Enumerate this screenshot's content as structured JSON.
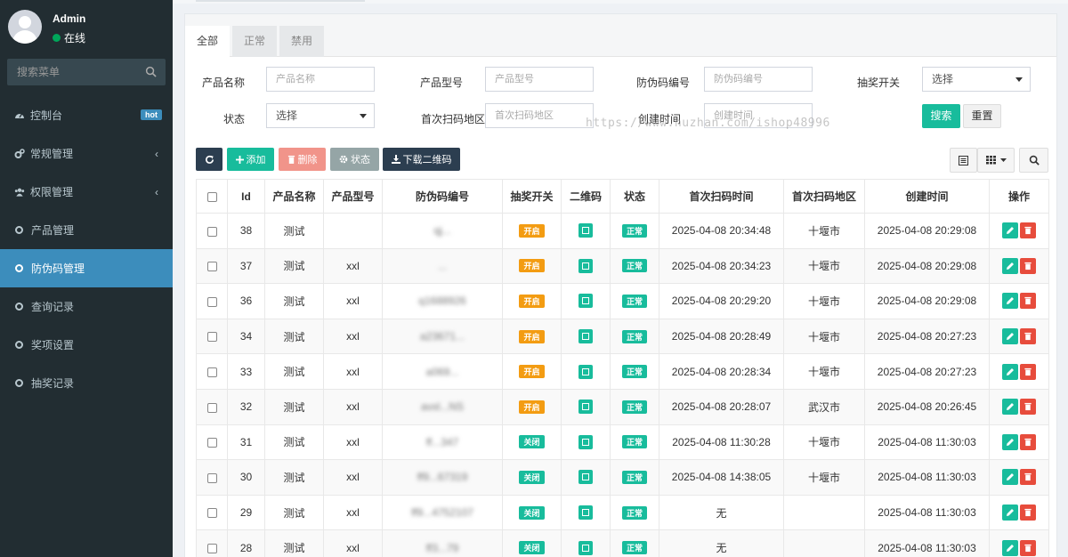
{
  "sidebar": {
    "user": {
      "name": "Admin",
      "status": "在线"
    },
    "search_placeholder": "搜索菜单",
    "menu": [
      {
        "label": "控制台",
        "icon": "dashboard-icon",
        "badge": "hot"
      },
      {
        "label": "常规管理",
        "icon": "cogs-icon",
        "chevron": "‹"
      },
      {
        "label": "权限管理",
        "icon": "group-icon",
        "chevron": "‹"
      },
      {
        "label": "产品管理",
        "icon": "circle-icon"
      },
      {
        "label": "防伪码管理",
        "icon": "circle-icon",
        "active": true
      },
      {
        "label": "查询记录",
        "icon": "circle-icon"
      },
      {
        "label": "奖项设置",
        "icon": "circle-icon"
      },
      {
        "label": "抽奖记录",
        "icon": "circle-icon"
      }
    ]
  },
  "tabs": [
    "全部",
    "正常",
    "禁用"
  ],
  "filter": {
    "product_name": {
      "label": "产品名称",
      "placeholder": "产品名称"
    },
    "product_model": {
      "label": "产品型号",
      "placeholder": "产品型号"
    },
    "code": {
      "label": "防伪码编号",
      "placeholder": "防伪码编号"
    },
    "lottery": {
      "label": "抽奖开关",
      "value": "选择"
    },
    "status": {
      "label": "状态",
      "value": "选择"
    },
    "region": {
      "label": "首次扫码地区",
      "placeholder": "首次扫码地区"
    },
    "created": {
      "label": "创建时间",
      "placeholder": "创建时间"
    },
    "search_btn": "搜索",
    "reset_btn": "重置"
  },
  "watermark": "https://www.huzhan.com/ishop48996",
  "toolbar": {
    "add": "添加",
    "delete": "删除",
    "status": "状态",
    "download_qr": "下载二维码"
  },
  "table": {
    "headers": [
      "Id",
      "产品名称",
      "产品型号",
      "防伪码编号",
      "抽奖开关",
      "二维码",
      "状态",
      "首次扫码时间",
      "首次扫码地区",
      "创建时间",
      "操作"
    ],
    "rows": [
      {
        "id": "38",
        "name": "测试",
        "model": "",
        "code": "qj...",
        "lottery": "开启",
        "status": "正常",
        "scan_time": "2025-04-08 20:34:48",
        "region": "十堰市",
        "created": "2025-04-08 20:29:08"
      },
      {
        "id": "37",
        "name": "测试",
        "model": "xxl",
        "code": "...",
        "lottery": "开启",
        "status": "正常",
        "scan_time": "2025-04-08 20:34:23",
        "region": "十堰市",
        "created": "2025-04-08 20:29:08"
      },
      {
        "id": "36",
        "name": "测试",
        "model": "xxl",
        "code": "q1688926",
        "lottery": "开启",
        "status": "正常",
        "scan_time": "2025-04-08 20:29:20",
        "region": "十堰市",
        "created": "2025-04-08 20:29:08"
      },
      {
        "id": "34",
        "name": "测试",
        "model": "xxl",
        "code": "a23671...",
        "lottery": "开启",
        "status": "正常",
        "scan_time": "2025-04-08 20:28:49",
        "region": "十堰市",
        "created": "2025-04-08 20:27:23"
      },
      {
        "id": "33",
        "name": "测试",
        "model": "xxl",
        "code": "a069...",
        "lottery": "开启",
        "status": "正常",
        "scan_time": "2025-04-08 20:28:34",
        "region": "十堰市",
        "created": "2025-04-08 20:27:23"
      },
      {
        "id": "32",
        "name": "测试",
        "model": "xxl",
        "code": "avxl...NS",
        "lottery": "开启",
        "status": "正常",
        "scan_time": "2025-04-08 20:28:07",
        "region": "武汉市",
        "created": "2025-04-08 20:26:45"
      },
      {
        "id": "31",
        "name": "测试",
        "model": "xxl",
        "code": "ff...347",
        "lottery": "关闭",
        "status": "正常",
        "scan_time": "2025-04-08 11:30:28",
        "region": "十堰市",
        "created": "2025-04-08 11:30:03"
      },
      {
        "id": "30",
        "name": "测试",
        "model": "xxl",
        "code": "ff9...67319",
        "lottery": "关闭",
        "status": "正常",
        "scan_time": "2025-04-08 14:38:05",
        "region": "十堰市",
        "created": "2025-04-08 11:30:03"
      },
      {
        "id": "29",
        "name": "测试",
        "model": "xxl",
        "code": "ff9...4752107",
        "lottery": "关闭",
        "status": "正常",
        "scan_time": "无",
        "region": "",
        "created": "2025-04-08 11:30:03"
      },
      {
        "id": "28",
        "name": "测试",
        "model": "xxl",
        "code": "ff3...79",
        "lottery": "关闭",
        "status": "正常",
        "scan_time": "无",
        "region": "",
        "created": "2025-04-08 11:30:03"
      }
    ]
  },
  "colors": {
    "sidebar_bg": "#222d32",
    "active_menu": "#3c8dbc",
    "success": "#18bc9c",
    "warning": "#f39c12",
    "danger": "#e74c3c"
  }
}
